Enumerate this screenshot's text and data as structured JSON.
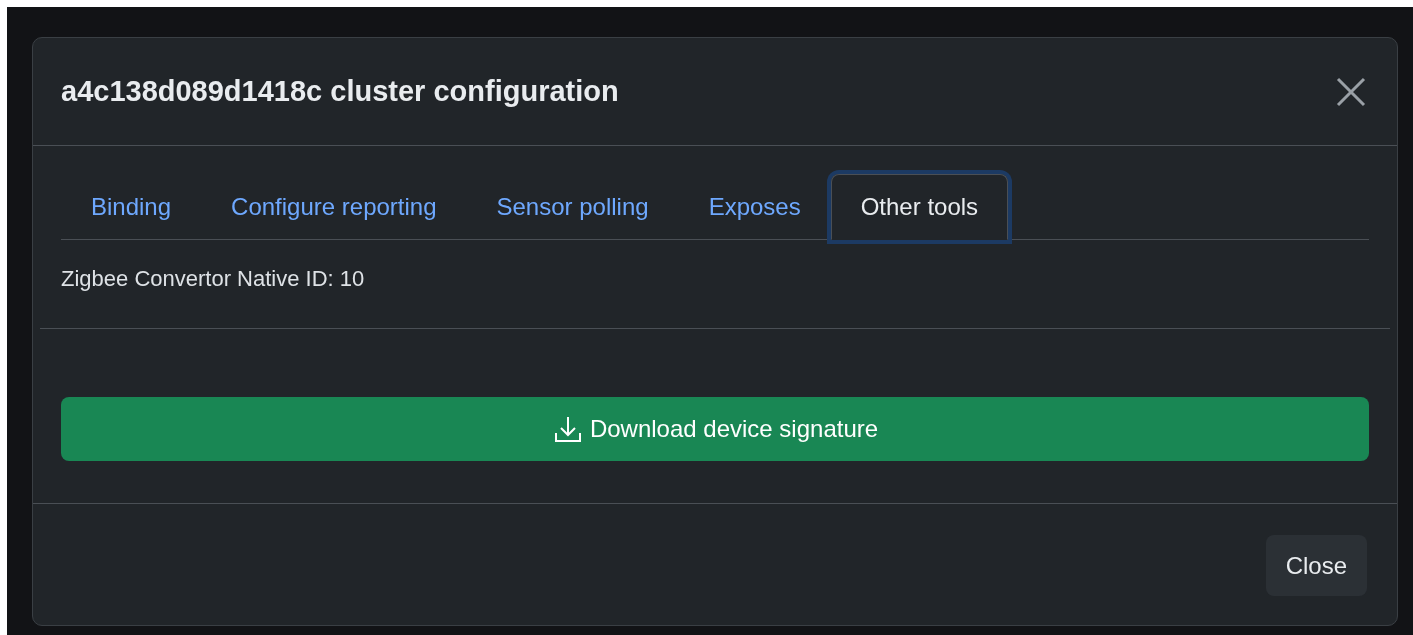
{
  "modal": {
    "title": "a4c138d089d1418c cluster configuration",
    "tabs": [
      {
        "label": "Binding",
        "selected": false
      },
      {
        "label": "Configure reporting",
        "selected": false
      },
      {
        "label": "Sensor polling",
        "selected": false
      },
      {
        "label": "Exposes",
        "selected": false
      },
      {
        "label": "Other tools",
        "selected": true
      }
    ],
    "info": "Zigbee Convertor Native ID: 10",
    "action_button": "Download device signature",
    "footer_button": "Close"
  }
}
